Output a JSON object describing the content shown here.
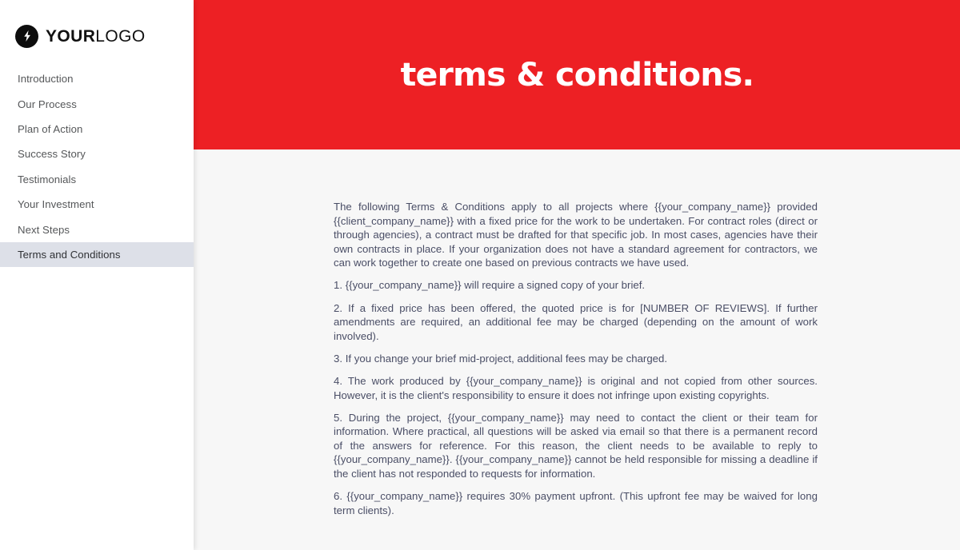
{
  "colors": {
    "banner_red": "#ED2024",
    "sidebar_bg": "#FFFFFF",
    "active_item_bg": "#DDE0E8",
    "content_bg": "#F7F7F7",
    "body_text": "#4A4E66",
    "nav_text": "#555759",
    "logo_black": "#0D0D0D"
  },
  "sidebar": {
    "logo": {
      "icon": "lightning-bolt-icon",
      "text_bold": "YOUR",
      "text_light": "LOGO"
    },
    "items": [
      {
        "label": "Introduction",
        "active": false
      },
      {
        "label": "Our Process",
        "active": false
      },
      {
        "label": "Plan of Action",
        "active": false
      },
      {
        "label": "Success Story",
        "active": false
      },
      {
        "label": "Testimonials",
        "active": false
      },
      {
        "label": "Your Investment",
        "active": false
      },
      {
        "label": "Next Steps",
        "active": false
      },
      {
        "label": "Terms and Conditions",
        "active": true
      }
    ]
  },
  "banner": {
    "title": "terms & conditions."
  },
  "document": {
    "paragraphs": [
      {
        "id": "intro",
        "text": "The following Terms & Conditions apply to all projects where {{your_company_name}} provided {{client_company_name}}  with a fixed price for the work to be undertaken. For contract roles (direct or through agencies), a contract must be drafted for that specific job. In most cases, agencies have their own contracts in place. If your organization does not have a standard agreement for contractors, we can work together to create one based on previous contracts we have used."
      },
      {
        "id": "clause-1",
        "text": "1. {{your_company_name}} will require a signed copy of your brief."
      },
      {
        "id": "clause-2",
        "text": "2. If a fixed price has been offered, the quoted price is for [NUMBER OF REVIEWS]. If further amendments are required, an additional fee may be charged (depending on the amount of work involved)."
      },
      {
        "id": "clause-3",
        "text": "3. If you change your brief mid-project, additional fees may be charged."
      },
      {
        "id": "clause-4",
        "text": "4. The work produced by {{your_company_name}} is original and not copied from other sources. However, it is the client's responsibility to ensure it does not infringe upon existing copyrights."
      },
      {
        "id": "clause-5",
        "text": "5. During the project, {{your_company_name}} may need to contact the client or their team for information. Where practical, all questions will be asked via email so that there is a permanent record of the answers for reference. For this reason, the client needs to be available to reply to {{your_company_name}}. {{your_company_name}} cannot be held responsible for missing a deadline if the client has not responded to requests for information."
      },
      {
        "id": "clause-6",
        "text": "6. {{your_company_name}} requires 30% payment upfront. (This upfront fee may be waived for long term clients)."
      }
    ]
  }
}
